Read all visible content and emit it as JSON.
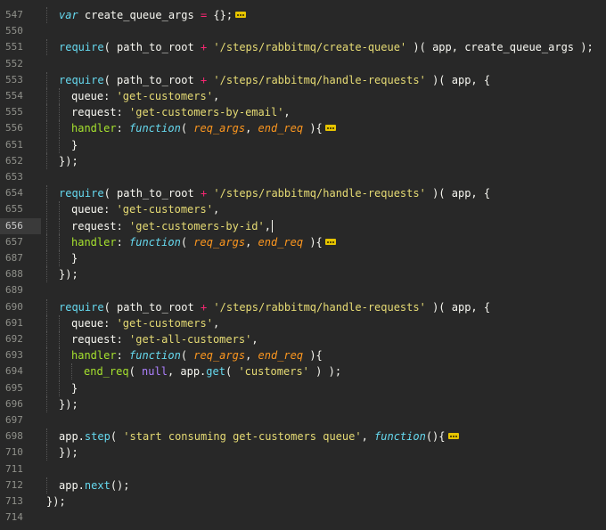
{
  "editor": {
    "current_line": "656",
    "lines": [
      {
        "num": "547",
        "indent": 1,
        "tokens": [
          {
            "t": "keyword",
            "v": "var"
          },
          {
            "t": "plain",
            "v": " create_queue_args "
          },
          {
            "t": "op",
            "v": "="
          },
          {
            "t": "plain",
            "v": " {};"
          },
          {
            "t": "fold",
            "v": ""
          }
        ]
      },
      {
        "num": "550",
        "indent": 0,
        "tokens": []
      },
      {
        "num": "551",
        "indent": 1,
        "tokens": [
          {
            "t": "func",
            "v": "require"
          },
          {
            "t": "plain",
            "v": "( path_to_root "
          },
          {
            "t": "op",
            "v": "+"
          },
          {
            "t": "plain",
            "v": " "
          },
          {
            "t": "string",
            "v": "'/steps/rabbitmq/create-queue'"
          },
          {
            "t": "plain",
            "v": " )( app, create_queue_args );"
          }
        ]
      },
      {
        "num": "552",
        "indent": 0,
        "tokens": []
      },
      {
        "num": "553",
        "indent": 1,
        "tokens": [
          {
            "t": "func",
            "v": "require"
          },
          {
            "t": "plain",
            "v": "( path_to_root "
          },
          {
            "t": "op",
            "v": "+"
          },
          {
            "t": "plain",
            "v": " "
          },
          {
            "t": "string",
            "v": "'/steps/rabbitmq/handle-requests'"
          },
          {
            "t": "plain",
            "v": " )( app, {"
          }
        ]
      },
      {
        "num": "554",
        "indent": 2,
        "tokens": [
          {
            "t": "plain",
            "v": "queue: "
          },
          {
            "t": "string",
            "v": "'get-customers'"
          },
          {
            "t": "plain",
            "v": ","
          }
        ]
      },
      {
        "num": "555",
        "indent": 2,
        "tokens": [
          {
            "t": "plain",
            "v": "request: "
          },
          {
            "t": "string",
            "v": "'get-customers-by-email'"
          },
          {
            "t": "plain",
            "v": ","
          }
        ]
      },
      {
        "num": "556",
        "indent": 2,
        "tokens": [
          {
            "t": "prop",
            "v": "handler"
          },
          {
            "t": "plain",
            "v": ": "
          },
          {
            "t": "keyword",
            "v": "function"
          },
          {
            "t": "plain",
            "v": "( "
          },
          {
            "t": "param",
            "v": "req_args"
          },
          {
            "t": "plain",
            "v": ", "
          },
          {
            "t": "param",
            "v": "end_req"
          },
          {
            "t": "plain",
            "v": " ){"
          },
          {
            "t": "fold",
            "v": ""
          }
        ]
      },
      {
        "num": "651",
        "indent": 2,
        "tokens": [
          {
            "t": "plain",
            "v": "}"
          }
        ]
      },
      {
        "num": "652",
        "indent": 1,
        "tokens": [
          {
            "t": "plain",
            "v": "});"
          }
        ]
      },
      {
        "num": "653",
        "indent": 0,
        "tokens": []
      },
      {
        "num": "654",
        "indent": 1,
        "tokens": [
          {
            "t": "func",
            "v": "require"
          },
          {
            "t": "plain",
            "v": "( path_to_root "
          },
          {
            "t": "op",
            "v": "+"
          },
          {
            "t": "plain",
            "v": " "
          },
          {
            "t": "string",
            "v": "'/steps/rabbitmq/handle-requests'"
          },
          {
            "t": "plain",
            "v": " )( app, {"
          }
        ]
      },
      {
        "num": "655",
        "indent": 2,
        "tokens": [
          {
            "t": "plain",
            "v": "queue: "
          },
          {
            "t": "string",
            "v": "'get-customers'"
          },
          {
            "t": "plain",
            "v": ","
          }
        ]
      },
      {
        "num": "656",
        "indent": 2,
        "tokens": [
          {
            "t": "plain",
            "v": "request: "
          },
          {
            "t": "string",
            "v": "'get-customers-by-id'"
          },
          {
            "t": "plain",
            "v": ","
          },
          {
            "t": "cursor",
            "v": ""
          }
        ]
      },
      {
        "num": "657",
        "indent": 2,
        "tokens": [
          {
            "t": "prop",
            "v": "handler"
          },
          {
            "t": "plain",
            "v": ": "
          },
          {
            "t": "keyword",
            "v": "function"
          },
          {
            "t": "plain",
            "v": "( "
          },
          {
            "t": "param",
            "v": "req_args"
          },
          {
            "t": "plain",
            "v": ", "
          },
          {
            "t": "param",
            "v": "end_req"
          },
          {
            "t": "plain",
            "v": " ){"
          },
          {
            "t": "fold",
            "v": ""
          }
        ]
      },
      {
        "num": "687",
        "indent": 2,
        "tokens": [
          {
            "t": "plain",
            "v": "}"
          }
        ]
      },
      {
        "num": "688",
        "indent": 1,
        "tokens": [
          {
            "t": "plain",
            "v": "});"
          }
        ]
      },
      {
        "num": "689",
        "indent": 0,
        "tokens": []
      },
      {
        "num": "690",
        "indent": 1,
        "tokens": [
          {
            "t": "func",
            "v": "require"
          },
          {
            "t": "plain",
            "v": "( path_to_root "
          },
          {
            "t": "op",
            "v": "+"
          },
          {
            "t": "plain",
            "v": " "
          },
          {
            "t": "string",
            "v": "'/steps/rabbitmq/handle-requests'"
          },
          {
            "t": "plain",
            "v": " )( app, {"
          }
        ]
      },
      {
        "num": "691",
        "indent": 2,
        "tokens": [
          {
            "t": "plain",
            "v": "queue: "
          },
          {
            "t": "string",
            "v": "'get-customers'"
          },
          {
            "t": "plain",
            "v": ","
          }
        ]
      },
      {
        "num": "692",
        "indent": 2,
        "tokens": [
          {
            "t": "plain",
            "v": "request: "
          },
          {
            "t": "string",
            "v": "'get-all-customers'"
          },
          {
            "t": "plain",
            "v": ","
          }
        ]
      },
      {
        "num": "693",
        "indent": 2,
        "tokens": [
          {
            "t": "prop",
            "v": "handler"
          },
          {
            "t": "plain",
            "v": ": "
          },
          {
            "t": "keyword",
            "v": "function"
          },
          {
            "t": "plain",
            "v": "( "
          },
          {
            "t": "param",
            "v": "req_args"
          },
          {
            "t": "plain",
            "v": ", "
          },
          {
            "t": "param",
            "v": "end_req"
          },
          {
            "t": "plain",
            "v": " ){"
          }
        ]
      },
      {
        "num": "694",
        "indent": 3,
        "tokens": [
          {
            "t": "prop",
            "v": "end_req"
          },
          {
            "t": "plain",
            "v": "( "
          },
          {
            "t": "const",
            "v": "null"
          },
          {
            "t": "plain",
            "v": ", app."
          },
          {
            "t": "func",
            "v": "get"
          },
          {
            "t": "plain",
            "v": "( "
          },
          {
            "t": "string",
            "v": "'customers'"
          },
          {
            "t": "plain",
            "v": " ) );"
          }
        ]
      },
      {
        "num": "695",
        "indent": 2,
        "tokens": [
          {
            "t": "plain",
            "v": "}"
          }
        ]
      },
      {
        "num": "696",
        "indent": 1,
        "tokens": [
          {
            "t": "plain",
            "v": "});"
          }
        ]
      },
      {
        "num": "697",
        "indent": 0,
        "tokens": []
      },
      {
        "num": "698",
        "indent": 1,
        "tokens": [
          {
            "t": "plain",
            "v": "app."
          },
          {
            "t": "func",
            "v": "step"
          },
          {
            "t": "plain",
            "v": "( "
          },
          {
            "t": "string",
            "v": "'start consuming get-customers queue'"
          },
          {
            "t": "plain",
            "v": ", "
          },
          {
            "t": "keyword",
            "v": "function"
          },
          {
            "t": "plain",
            "v": "(){"
          },
          {
            "t": "fold",
            "v": ""
          }
        ]
      },
      {
        "num": "710",
        "indent": 1,
        "tokens": [
          {
            "t": "plain",
            "v": "});"
          }
        ]
      },
      {
        "num": "711",
        "indent": 0,
        "tokens": []
      },
      {
        "num": "712",
        "indent": 1,
        "tokens": [
          {
            "t": "plain",
            "v": "app."
          },
          {
            "t": "func",
            "v": "next"
          },
          {
            "t": "plain",
            "v": "();"
          }
        ]
      },
      {
        "num": "713",
        "indent": 0,
        "tokens": [
          {
            "t": "plain",
            "v": "});"
          }
        ]
      },
      {
        "num": "714",
        "indent": 0,
        "tokens": []
      }
    ]
  }
}
